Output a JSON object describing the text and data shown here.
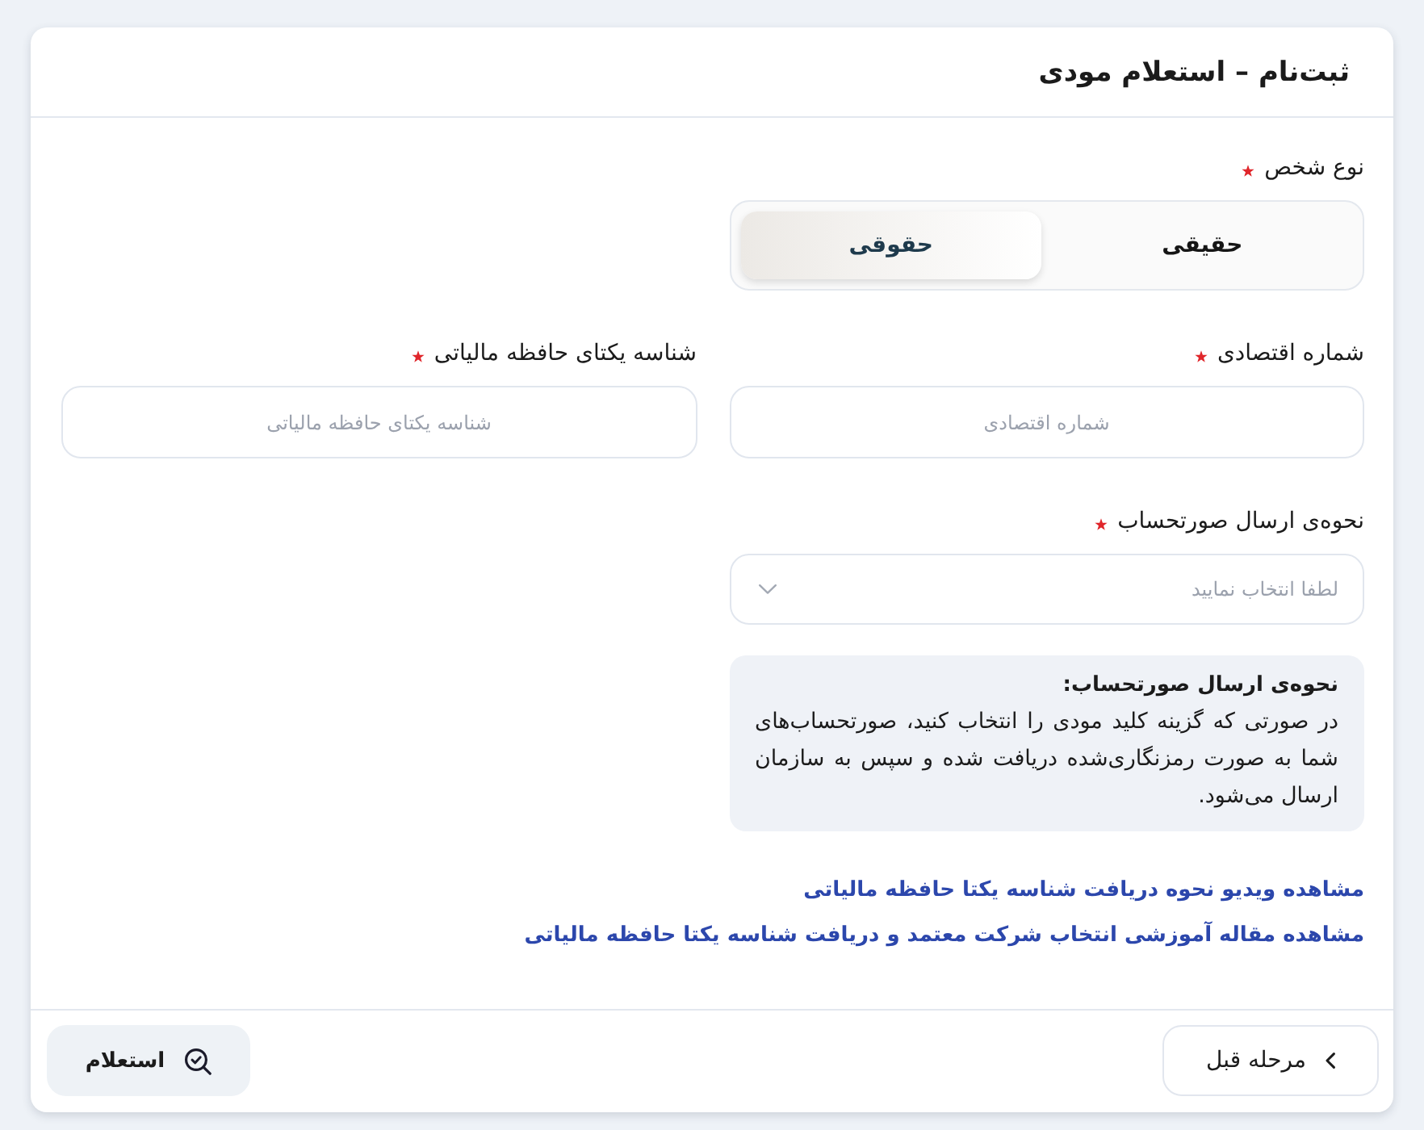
{
  "header": {
    "title": "ثبت‌نام – استعلام مودی"
  },
  "person_type": {
    "label": "نوع شخص",
    "required": true,
    "options": [
      {
        "label": "حقیقی",
        "selected": false
      },
      {
        "label": "حقوقی",
        "selected": true
      }
    ]
  },
  "fields": [
    {
      "label": "شماره اقتصادی",
      "required": true,
      "placeholder": "شماره اقتصادی"
    },
    {
      "label": "شناسه یکتای حافظه مالیاتی",
      "required": true,
      "placeholder": "شناسه یکتای حافظه مالیاتی"
    }
  ],
  "invoice_method": {
    "label": "نحوه‌ی ارسال صورتحساب",
    "required": true,
    "placeholder": "لطفا انتخاب نمایید"
  },
  "info_box": {
    "title": "نحوه‌ی ارسال صورتحساب:",
    "text": "در صورتی که گزینه کلید مودی را انتخاب کنید، صورتحساب‌های شما به صورت رمزنگاری‌شده دریافت شده و سپس به سازمان ارسال می‌شود."
  },
  "links": [
    "مشاهده ویدیو نحوه دریافت شناسه یکتا حافظه مالیاتی",
    "مشاهده مقاله آموزشی انتخاب شرکت معتمد و دریافت شناسه یکتا حافظه مالیاتی"
  ],
  "footer": {
    "back_button": "مرحله قبل",
    "inquiry_button": "استعلام"
  }
}
